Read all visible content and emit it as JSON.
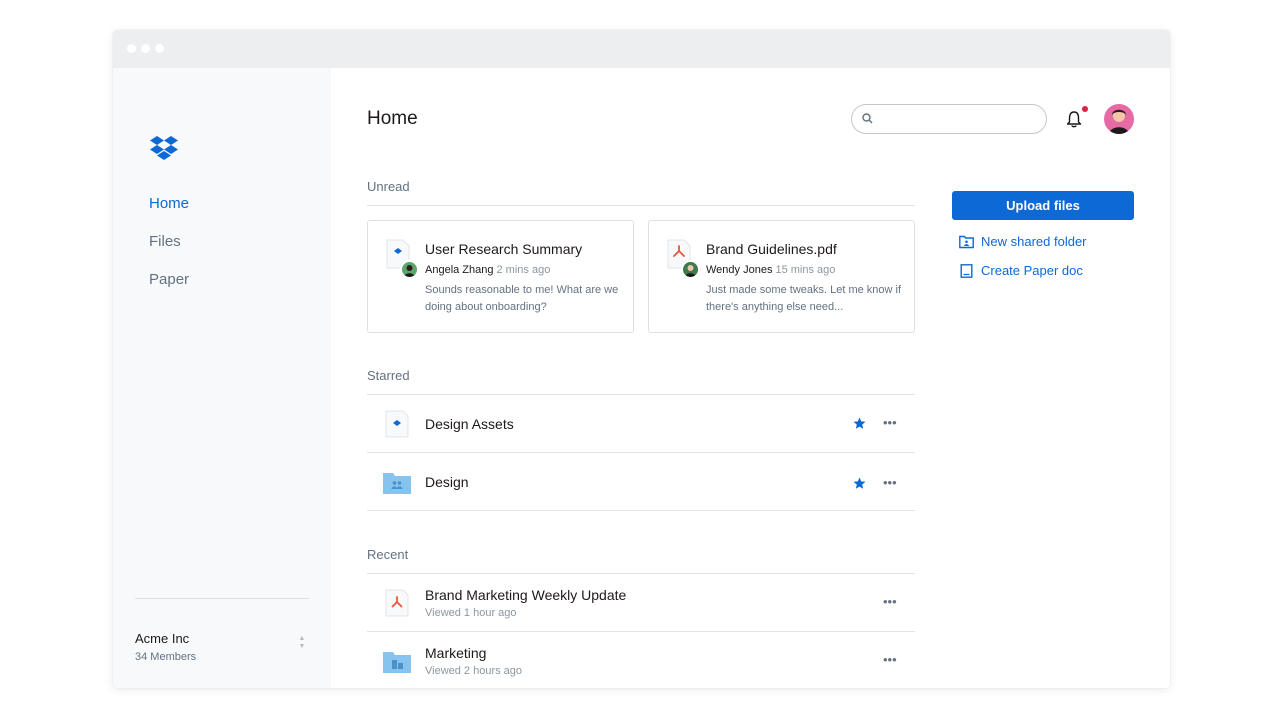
{
  "sidebar": {
    "items": [
      {
        "label": "Home",
        "active": true
      },
      {
        "label": "Files",
        "active": false
      },
      {
        "label": "Paper",
        "active": false
      }
    ],
    "team": {
      "name": "Acme Inc",
      "members": "34 Members"
    }
  },
  "header": {
    "title": "Home",
    "search": {
      "value": "",
      "placeholder": ""
    },
    "notification_unread": true
  },
  "unread": {
    "label": "Unread",
    "cards": [
      {
        "title": "User Research Summary",
        "author": "Angela Zhang",
        "time": "2 mins ago",
        "text": "Sounds reasonable to me! What are we doing about onboarding?",
        "icon": "paper-doc-icon"
      },
      {
        "title": "Brand Guidelines.pdf",
        "author": "Wendy Jones",
        "time": "15 mins ago",
        "text": "Just made some tweaks. Let me know if there's anything else need...",
        "icon": "pdf-icon"
      }
    ]
  },
  "starred": {
    "label": "Starred",
    "items": [
      {
        "title": "Design Assets",
        "icon": "paper-doc-icon",
        "starred": true
      },
      {
        "title": "Design",
        "icon": "shared-folder-icon",
        "starred": true
      }
    ]
  },
  "recent": {
    "label": "Recent",
    "items": [
      {
        "title": "Brand Marketing Weekly Update",
        "subtitle": "Viewed 1 hour ago",
        "icon": "pdf-icon"
      },
      {
        "title": "Marketing",
        "subtitle": "Viewed 2 hours ago",
        "icon": "team-folder-icon"
      }
    ]
  },
  "actions": {
    "upload": "Upload files",
    "new_shared_folder": "New shared folder",
    "create_paper_doc": "Create Paper doc"
  },
  "colors": {
    "accent": "#0d69d5",
    "sidebar_bg": "#f7f9fa",
    "folder": "#86c3ee",
    "pdf": "#e9553d",
    "notification": "#e0213b"
  }
}
